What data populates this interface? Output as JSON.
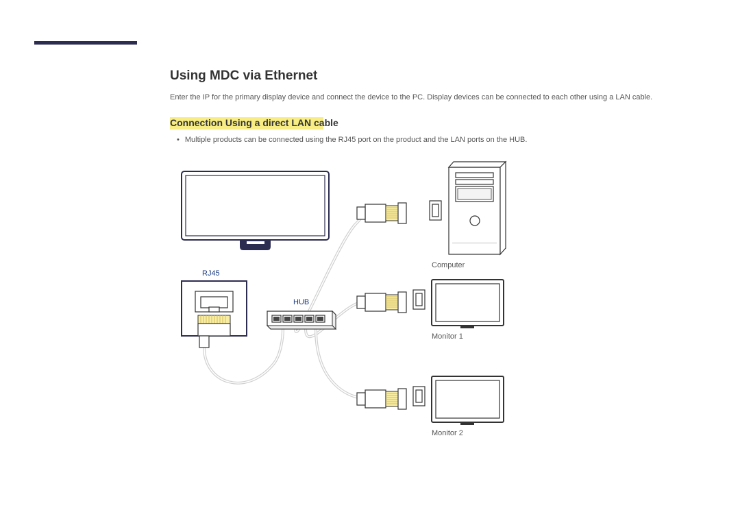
{
  "heading": "Using MDC via Ethernet",
  "body": "Enter the IP for the primary display device and connect the device to the PC. Display devices can be connected to each other using a LAN cable.",
  "subheading": "Connection Using a direct LAN cable",
  "bullet": "Multiple products can be connected using the RJ45 port on the product and the LAN ports on the HUB.",
  "labels": {
    "rj45": "RJ45",
    "hub": "HUB",
    "computer": "Computer",
    "monitor1": "Monitor 1",
    "monitor2": "Monitor 2"
  }
}
